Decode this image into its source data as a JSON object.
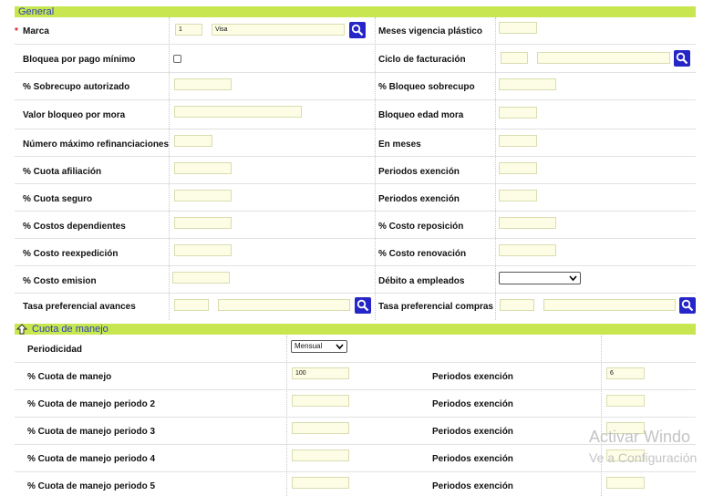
{
  "sections": {
    "general": "General",
    "cuota_manejo": "Cuota de manejo"
  },
  "colors": {
    "section_bar": "#c8e650",
    "section_text": "#2a40b8",
    "search_button": "#2626c8",
    "required": "#d42020"
  },
  "icons": {
    "search": "magnifier-icon",
    "collapse": "arrow-up-icon"
  },
  "general": {
    "marca": {
      "label": "Marca",
      "required_mark": "*",
      "code": "1",
      "name": "Visa"
    },
    "meses_vigencia": {
      "label": "Meses vigencia plástico",
      "value": ""
    },
    "bloquea_pago_minimo": {
      "label": "Bloquea por pago mínimo",
      "checked": false
    },
    "ciclo_facturacion": {
      "label": "Ciclo de facturación",
      "code": "",
      "name": ""
    },
    "sobrecupo_autorizado": {
      "label": "% Sobrecupo autorizado",
      "value": ""
    },
    "bloqueo_sobrecupo": {
      "label": "% Bloqueo sobrecupo",
      "value": ""
    },
    "valor_bloqueo_mora": {
      "label": "Valor bloqueo por mora",
      "value": ""
    },
    "bloqueo_edad_mora": {
      "label": "Bloqueo edad mora",
      "value": ""
    },
    "num_max_refinanciaciones": {
      "label": "Número máximo refinanciaciones",
      "value": ""
    },
    "en_meses": {
      "label": "En meses",
      "value": ""
    },
    "cuota_afiliacion": {
      "label": "% Cuota afiliación",
      "value": ""
    },
    "periodos_exencion_1": {
      "label": "Periodos exención",
      "value": ""
    },
    "cuota_seguro": {
      "label": "% Cuota seguro",
      "value": ""
    },
    "periodos_exencion_2": {
      "label": "Periodos exención",
      "value": ""
    },
    "costos_dependientes": {
      "label": "% Costos dependientes",
      "value": ""
    },
    "costo_reposicion": {
      "label": "% Costo reposición",
      "value": ""
    },
    "costo_reexpedicion": {
      "label": "% Costo reexpedición",
      "value": ""
    },
    "costo_renovacion": {
      "label": "% Costo renovación",
      "value": ""
    },
    "costo_emision": {
      "label": "% Costo emision",
      "value": ""
    },
    "debito_empleados": {
      "label": "Débito a empleados",
      "selected": ""
    },
    "tasa_pref_avances": {
      "label": "Tasa preferencial avances",
      "code": "",
      "name": ""
    },
    "tasa_pref_compras": {
      "label": "Tasa preferencial compras",
      "code": "",
      "name": ""
    }
  },
  "cuota_manejo": {
    "periodicidad": {
      "label": "Periodicidad",
      "selected": "Mensual"
    },
    "rows": [
      {
        "label": "% Cuota de manejo",
        "value": "100",
        "exencion_label": "Periodos exención",
        "exencion_value": "6"
      },
      {
        "label": "% Cuota de manejo periodo 2",
        "value": "",
        "exencion_label": "Periodos exención",
        "exencion_value": ""
      },
      {
        "label": "% Cuota de manejo periodo 3",
        "value": "",
        "exencion_label": "Periodos exención",
        "exencion_value": ""
      },
      {
        "label": "% Cuota de manejo periodo 4",
        "value": "",
        "exencion_label": "Periodos exención",
        "exencion_value": ""
      },
      {
        "label": "% Cuota de manejo periodo 5",
        "value": "",
        "exencion_label": "Periodos exención",
        "exencion_value": ""
      }
    ]
  },
  "watermark": {
    "line1": "Activar Windo",
    "line2": "Ve a Configuración"
  }
}
